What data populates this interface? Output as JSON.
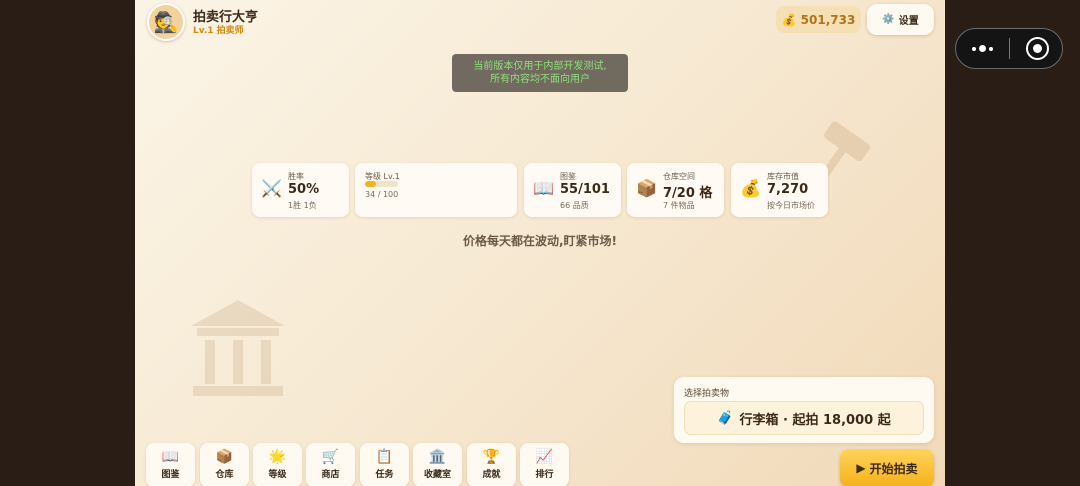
{
  "header": {
    "avatar_icon": "🕵️",
    "name": "拍卖行大亨",
    "level": "Lv.1 拍卖师",
    "coin_icon": "💰",
    "coins": "501,733",
    "settings_icon": "⚙️",
    "settings_label": "设置"
  },
  "notice": {
    "line1": "当前版本仅用于内部开发测试,",
    "line2": "所有内容均不面向用户"
  },
  "stats": {
    "win": {
      "icon": "⚔️",
      "label": "胜率",
      "value": "50%",
      "sub": "1胜 1负"
    },
    "level": {
      "label": "等级 Lv.1",
      "progress": 0.34,
      "sub": "34 / 100"
    },
    "codex": {
      "icon": "📖",
      "label": "图鉴",
      "value": "55/101",
      "sub": "66 品质"
    },
    "warehouse": {
      "icon": "📦",
      "label": "仓库空间",
      "value": "7/20 格",
      "sub": "7 件物品"
    },
    "market": {
      "icon": "💰",
      "label": "库存市值",
      "value": "7,270",
      "sub": "按今日市场价"
    }
  },
  "tagline": "价格每天都在波动,盯紧市场!",
  "auction": {
    "title": "选择拍卖物",
    "item_icon": "🧳",
    "item_text": "行李箱 · 起拍 18,000 起",
    "start_icon": "▶",
    "start_label": "开始拍卖"
  },
  "nav": [
    {
      "icon": "📖",
      "label": "图鉴"
    },
    {
      "icon": "📦",
      "label": "仓库"
    },
    {
      "icon": "🌟",
      "label": "等级"
    },
    {
      "icon": "🛒",
      "label": "商店"
    },
    {
      "icon": "📋",
      "label": "任务"
    },
    {
      "icon": "🏛️",
      "label": "收藏室"
    },
    {
      "icon": "🏆",
      "label": "成就"
    },
    {
      "icon": "📈",
      "label": "排行"
    }
  ],
  "colors": {
    "accent": "#f5b11c",
    "coin_text": "#b0741a",
    "level_text": "#d48a12",
    "notice_text": "#8ee07a"
  }
}
